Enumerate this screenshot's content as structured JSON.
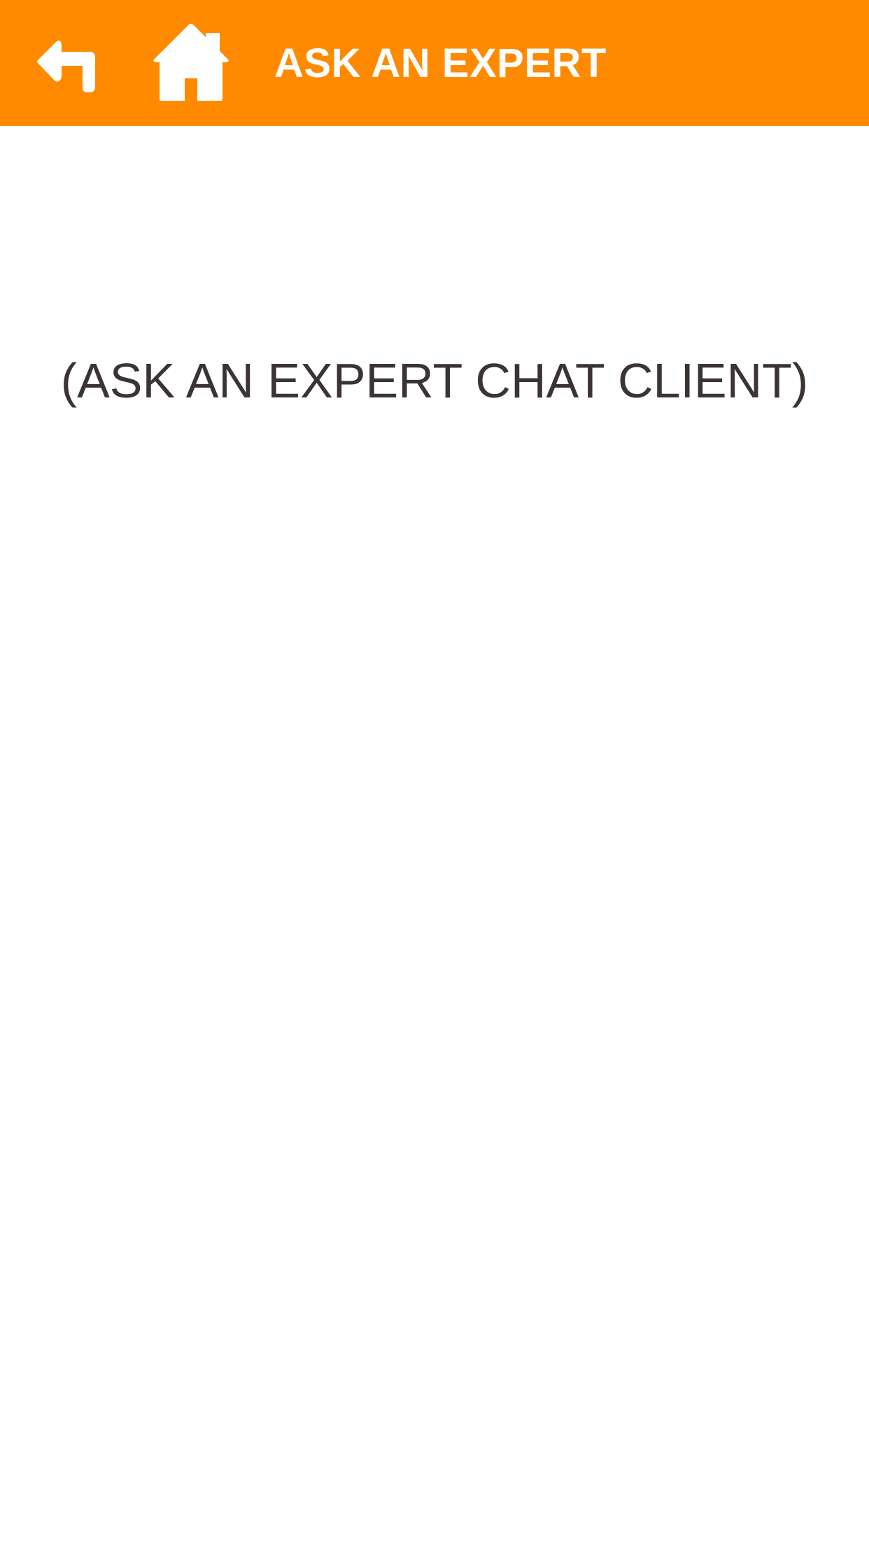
{
  "header": {
    "title": "ASK AN EXPERT",
    "background_color": "#FF8A00",
    "back_icon": "back-arrow-icon",
    "home_icon": "home-icon"
  },
  "content": {
    "placeholder_text": "(ASK AN EXPERT CHAT CLIENT)",
    "text_color": "#3b3335"
  }
}
